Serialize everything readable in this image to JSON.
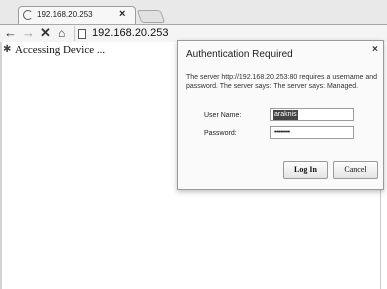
{
  "tab": {
    "title": "192.168.20.253"
  },
  "toolbar": {
    "address": "192.168.20.253"
  },
  "page": {
    "status_text": "Accessing Device ..."
  },
  "dialog": {
    "title": "Authentication Required",
    "message": "The server http://192.168.20.253:80 requires a username and password. The server says: The server says: Managed.",
    "username_label": "User Name:",
    "username_value": "araknis",
    "password_label": "Password:",
    "password_value": "••••••••",
    "login_label": "Log In",
    "cancel_label": "Cancel"
  },
  "icons": {
    "tab": "page-icon",
    "back": "back-arrow-icon",
    "forward": "forward-arrow-icon",
    "stop": "stop-icon",
    "home": "home-icon",
    "page": "page-icon",
    "loading": "loading-spinner-icon",
    "close": "close-icon"
  }
}
